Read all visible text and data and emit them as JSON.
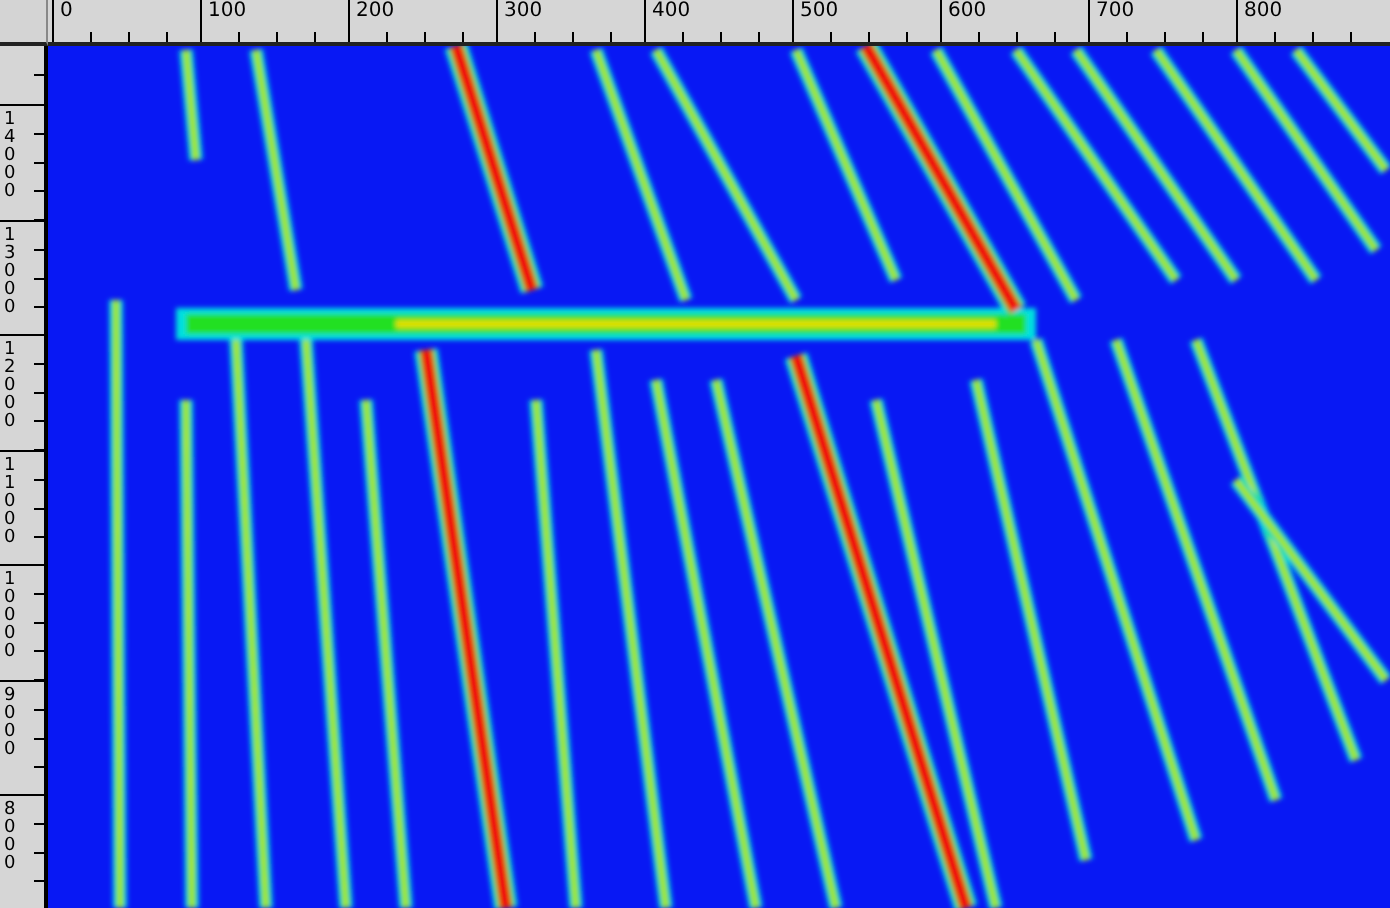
{
  "top_ruler": {
    "labels": [
      "0",
      "100",
      "200",
      "300",
      "400",
      "500",
      "600",
      "700",
      "800"
    ]
  },
  "left_ruler": {
    "labels": [
      "14000",
      "13000",
      "12000",
      "11000",
      "10000",
      "9000",
      "8000"
    ]
  }
}
